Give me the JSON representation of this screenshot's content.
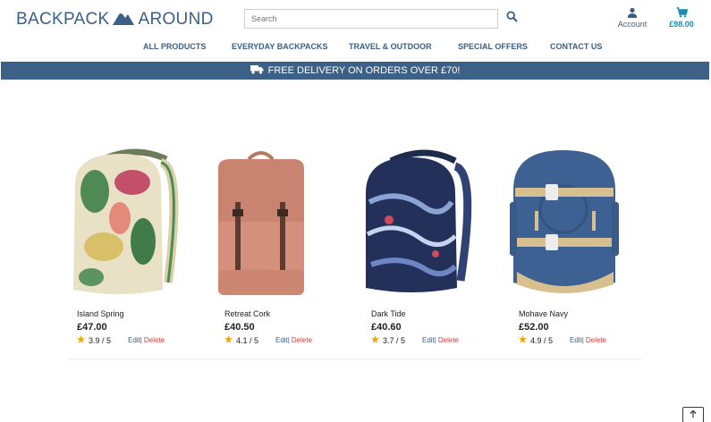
{
  "header": {
    "logo_left": "BACKPACK",
    "logo_right": "AROUND",
    "search_placeholder": "Search",
    "account_label": "Account",
    "cart_total": "£98.00"
  },
  "nav": {
    "items": [
      "ALL PRODUCTS",
      "EVERYDAY BACKPACKS",
      "TRAVEL & OUTDOOR",
      "SPECIAL OFFERS",
      "CONTACT US"
    ]
  },
  "banner": {
    "text": "FREE DELIVERY ON ORDERS OVER £70!"
  },
  "products": [
    {
      "name": "Island Spring",
      "price": "£47.00",
      "rating": "3.9 / 5",
      "edit": "Edit",
      "delete": "Delete"
    },
    {
      "name": "Retreat Cork",
      "price": "£40.50",
      "rating": "4.1 / 5",
      "edit": "Edit",
      "delete": "Delete"
    },
    {
      "name": "Dark Tide",
      "price": "£40.60",
      "rating": "3.7 / 5",
      "edit": "Edit",
      "delete": "Delete"
    },
    {
      "name": "Mohave Navy",
      "price": "£52.00",
      "rating": "4.9 / 5",
      "edit": "Edit",
      "delete": "Delete"
    }
  ],
  "colors": {
    "brand": "#3b5f86",
    "banner": "#3d6186",
    "cart": "#1a8bb8",
    "delete": "#d23c3c",
    "star": "#f0a500"
  },
  "icons": {
    "search": "search-icon",
    "account": "user-icon",
    "cart": "cart-icon",
    "truck": "truck-icon",
    "back_to_top": "arrow-up-icon"
  }
}
